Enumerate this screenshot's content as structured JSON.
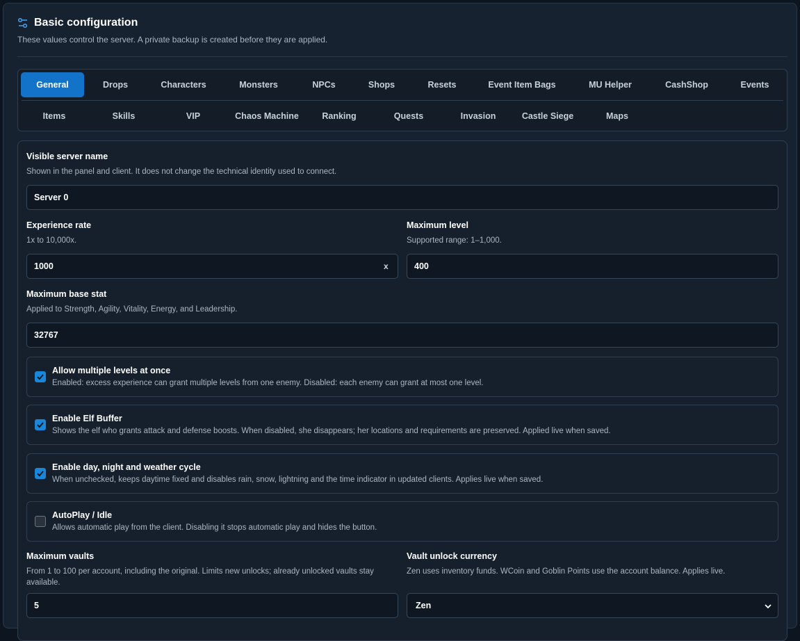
{
  "header": {
    "title": "Basic configuration",
    "subtitle": "These values control the server. A private backup is created before they are applied."
  },
  "tabs": {
    "row1": [
      "General",
      "Drops",
      "Characters",
      "Monsters",
      "NPCs",
      "Shops",
      "Resets",
      "Event Item Bags",
      "MU Helper",
      "CashShop",
      "Events"
    ],
    "row2": [
      "Items",
      "Skills",
      "VIP",
      "Chaos Machine",
      "Ranking",
      "Quests",
      "Invasion",
      "Castle Siege",
      "Maps"
    ],
    "active": "General"
  },
  "fields": {
    "server_name": {
      "label": "Visible server name",
      "help": "Shown in the panel and client. It does not change the technical identity used to connect.",
      "value": "Server 0"
    },
    "exp_rate": {
      "label": "Experience rate",
      "help": "1x to 10,000x.",
      "value": "1000",
      "clear": "x"
    },
    "max_level": {
      "label": "Maximum level",
      "help": "Supported range: 1–1,000.",
      "value": "400"
    },
    "max_stat": {
      "label": "Maximum base stat",
      "help": "Applied to Strength, Agility, Vitality, Energy, and Leadership.",
      "value": "32767"
    },
    "max_vaults": {
      "label": "Maximum vaults",
      "help": "From 1 to 100 per account, including the original. Limits new unlocks; already unlocked vaults stay available.",
      "value": "5"
    },
    "vault_currency": {
      "label": "Vault unlock currency",
      "help": "Zen uses inventory funds. WCoin and Goblin Points use the account balance. Applies live.",
      "value": "Zen"
    }
  },
  "checks": [
    {
      "title": "Allow multiple levels at once",
      "desc": "Enabled: excess experience can grant multiple levels from one enemy. Disabled: each enemy can grant at most one level.",
      "checked": true
    },
    {
      "title": "Enable Elf Buffer",
      "desc": "Shows the elf who grants attack and defense boosts. When disabled, she disappears; her locations and requirements are preserved. Applied live when saved.",
      "checked": true
    },
    {
      "title": "Enable day, night and weather cycle",
      "desc": "When unchecked, keeps daytime fixed and disables rain, snow, lightning and the time indicator in updated clients. Applies live when saved.",
      "checked": true
    },
    {
      "title": "AutoPlay / Idle",
      "desc": "Allows automatic play from the client. Disabling it stops automatic play and hides the button.",
      "checked": false
    }
  ],
  "colors": {
    "accent": "#1273c8",
    "checkbox_on": "#1a86d8",
    "panel": "#172230"
  }
}
